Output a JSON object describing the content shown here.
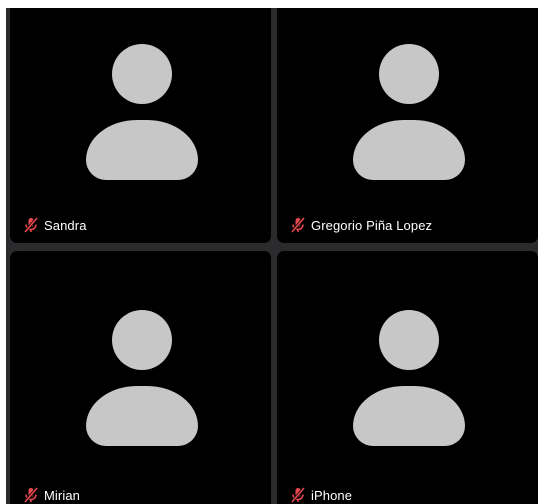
{
  "participants": [
    {
      "name": "Sandra",
      "muted": true,
      "avatar_icon": "person-placeholder-icon"
    },
    {
      "name": "Gregorio Piña Lopez",
      "muted": true,
      "avatar_icon": "person-placeholder-icon"
    },
    {
      "name": "Mirian",
      "muted": true,
      "avatar_icon": "person-placeholder-icon"
    },
    {
      "name": "iPhone",
      "muted": true,
      "avatar_icon": "person-placeholder-icon"
    }
  ],
  "colors": {
    "tile_background": "#000000",
    "grid_gap": "#2b2b2d",
    "avatar": "#c7c7c7",
    "mute_icon": "#e8484f",
    "name_text": "#ffffff"
  }
}
